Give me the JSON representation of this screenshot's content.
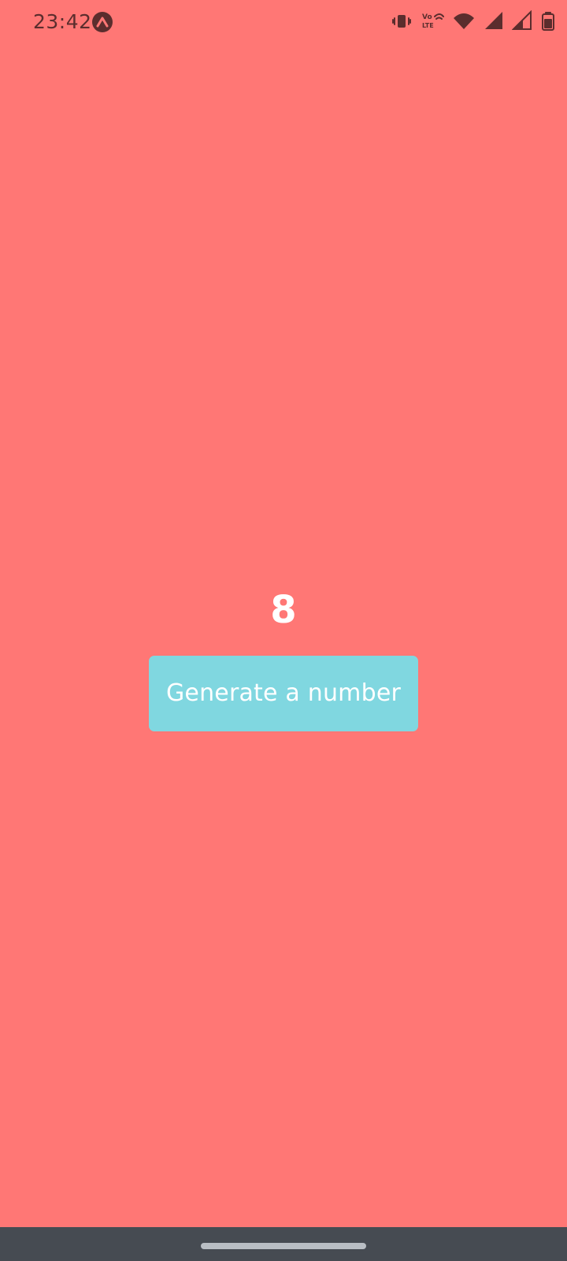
{
  "status_bar": {
    "time": "23:42",
    "icons": [
      "app-badge-icon",
      "vibrate-icon",
      "volte-icon",
      "wifi-icon",
      "signal-icon",
      "signal-2-icon",
      "battery-icon"
    ],
    "volte_text_top": "Vo",
    "volte_text_bottom": "LTE"
  },
  "main": {
    "number": "8",
    "button_label": "Generate a number"
  },
  "colors": {
    "background": "#FF7775",
    "button": "#80D7E0",
    "text": "#FFFFFF",
    "status_text": "#5B2D2D",
    "nav_bar": "#464B52"
  }
}
